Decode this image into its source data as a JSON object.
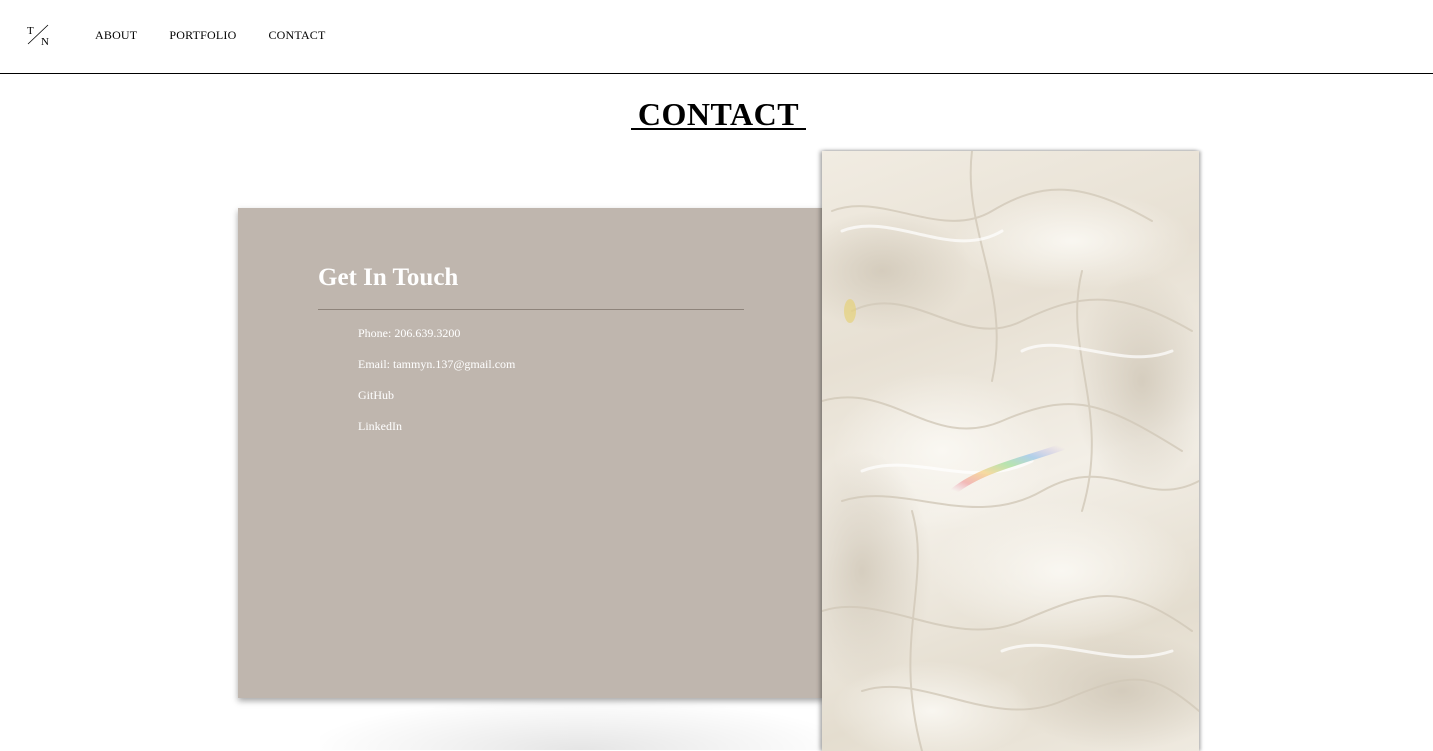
{
  "header": {
    "logo_alt": "TN",
    "nav": [
      {
        "label": "ABOUT"
      },
      {
        "label": "PORTFOLIO"
      },
      {
        "label": "CONTACT"
      }
    ]
  },
  "main": {
    "page_title": "CONTACT",
    "card": {
      "heading": "Get In Touch",
      "items": [
        {
          "label": "Phone: 206.639.3200"
        },
        {
          "label": "Email: tammyn.137@gmail.com"
        },
        {
          "label": "GitHub"
        },
        {
          "label": "LinkedIn"
        }
      ]
    },
    "image": {
      "icon": "crumpled-fabric-photo"
    }
  },
  "colors": {
    "card_background": "#bfb6ae",
    "card_text": "#ffffff",
    "divider": "#8e847b",
    "header_border": "#000000"
  }
}
